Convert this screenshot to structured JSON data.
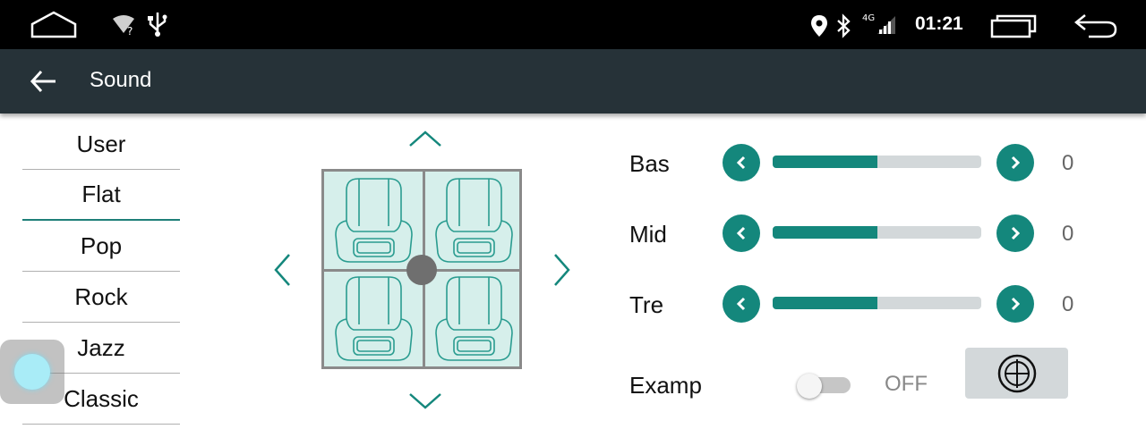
{
  "statusbar": {
    "time": "01:21",
    "network_type": "4G",
    "icons": [
      "home-icon",
      "wifi-unknown-icon",
      "usb-icon",
      "location-icon",
      "bluetooth-icon",
      "signal-icon",
      "recents-icon",
      "back-nav-icon"
    ]
  },
  "toolbar": {
    "title": "Sound",
    "back_icon": "back-arrow-icon"
  },
  "presets": {
    "selected": "Flat",
    "items": [
      "User",
      "Flat",
      "Pop",
      "Rock",
      "Jazz",
      "Classic"
    ]
  },
  "balance": {
    "icons": [
      "balance-up-icon",
      "balance-down-icon",
      "balance-left-icon",
      "balance-right-icon"
    ],
    "seat_icon": "car-seat-icon"
  },
  "eq": {
    "bass": {
      "label": "Bas",
      "value": "0",
      "level": 0.5
    },
    "mid": {
      "label": "Mid",
      "value": "0",
      "level": 0.5
    },
    "treble": {
      "label": "Tre",
      "value": "0",
      "level": 0.5
    }
  },
  "amp": {
    "label": "Examp",
    "state": "OFF",
    "subwoofer_icon": "subwoofer-icon"
  },
  "colors": {
    "accent": "#14877c",
    "toolbar": "#263238",
    "car_fill": "#d6efeb",
    "track": "#d3d8da"
  }
}
